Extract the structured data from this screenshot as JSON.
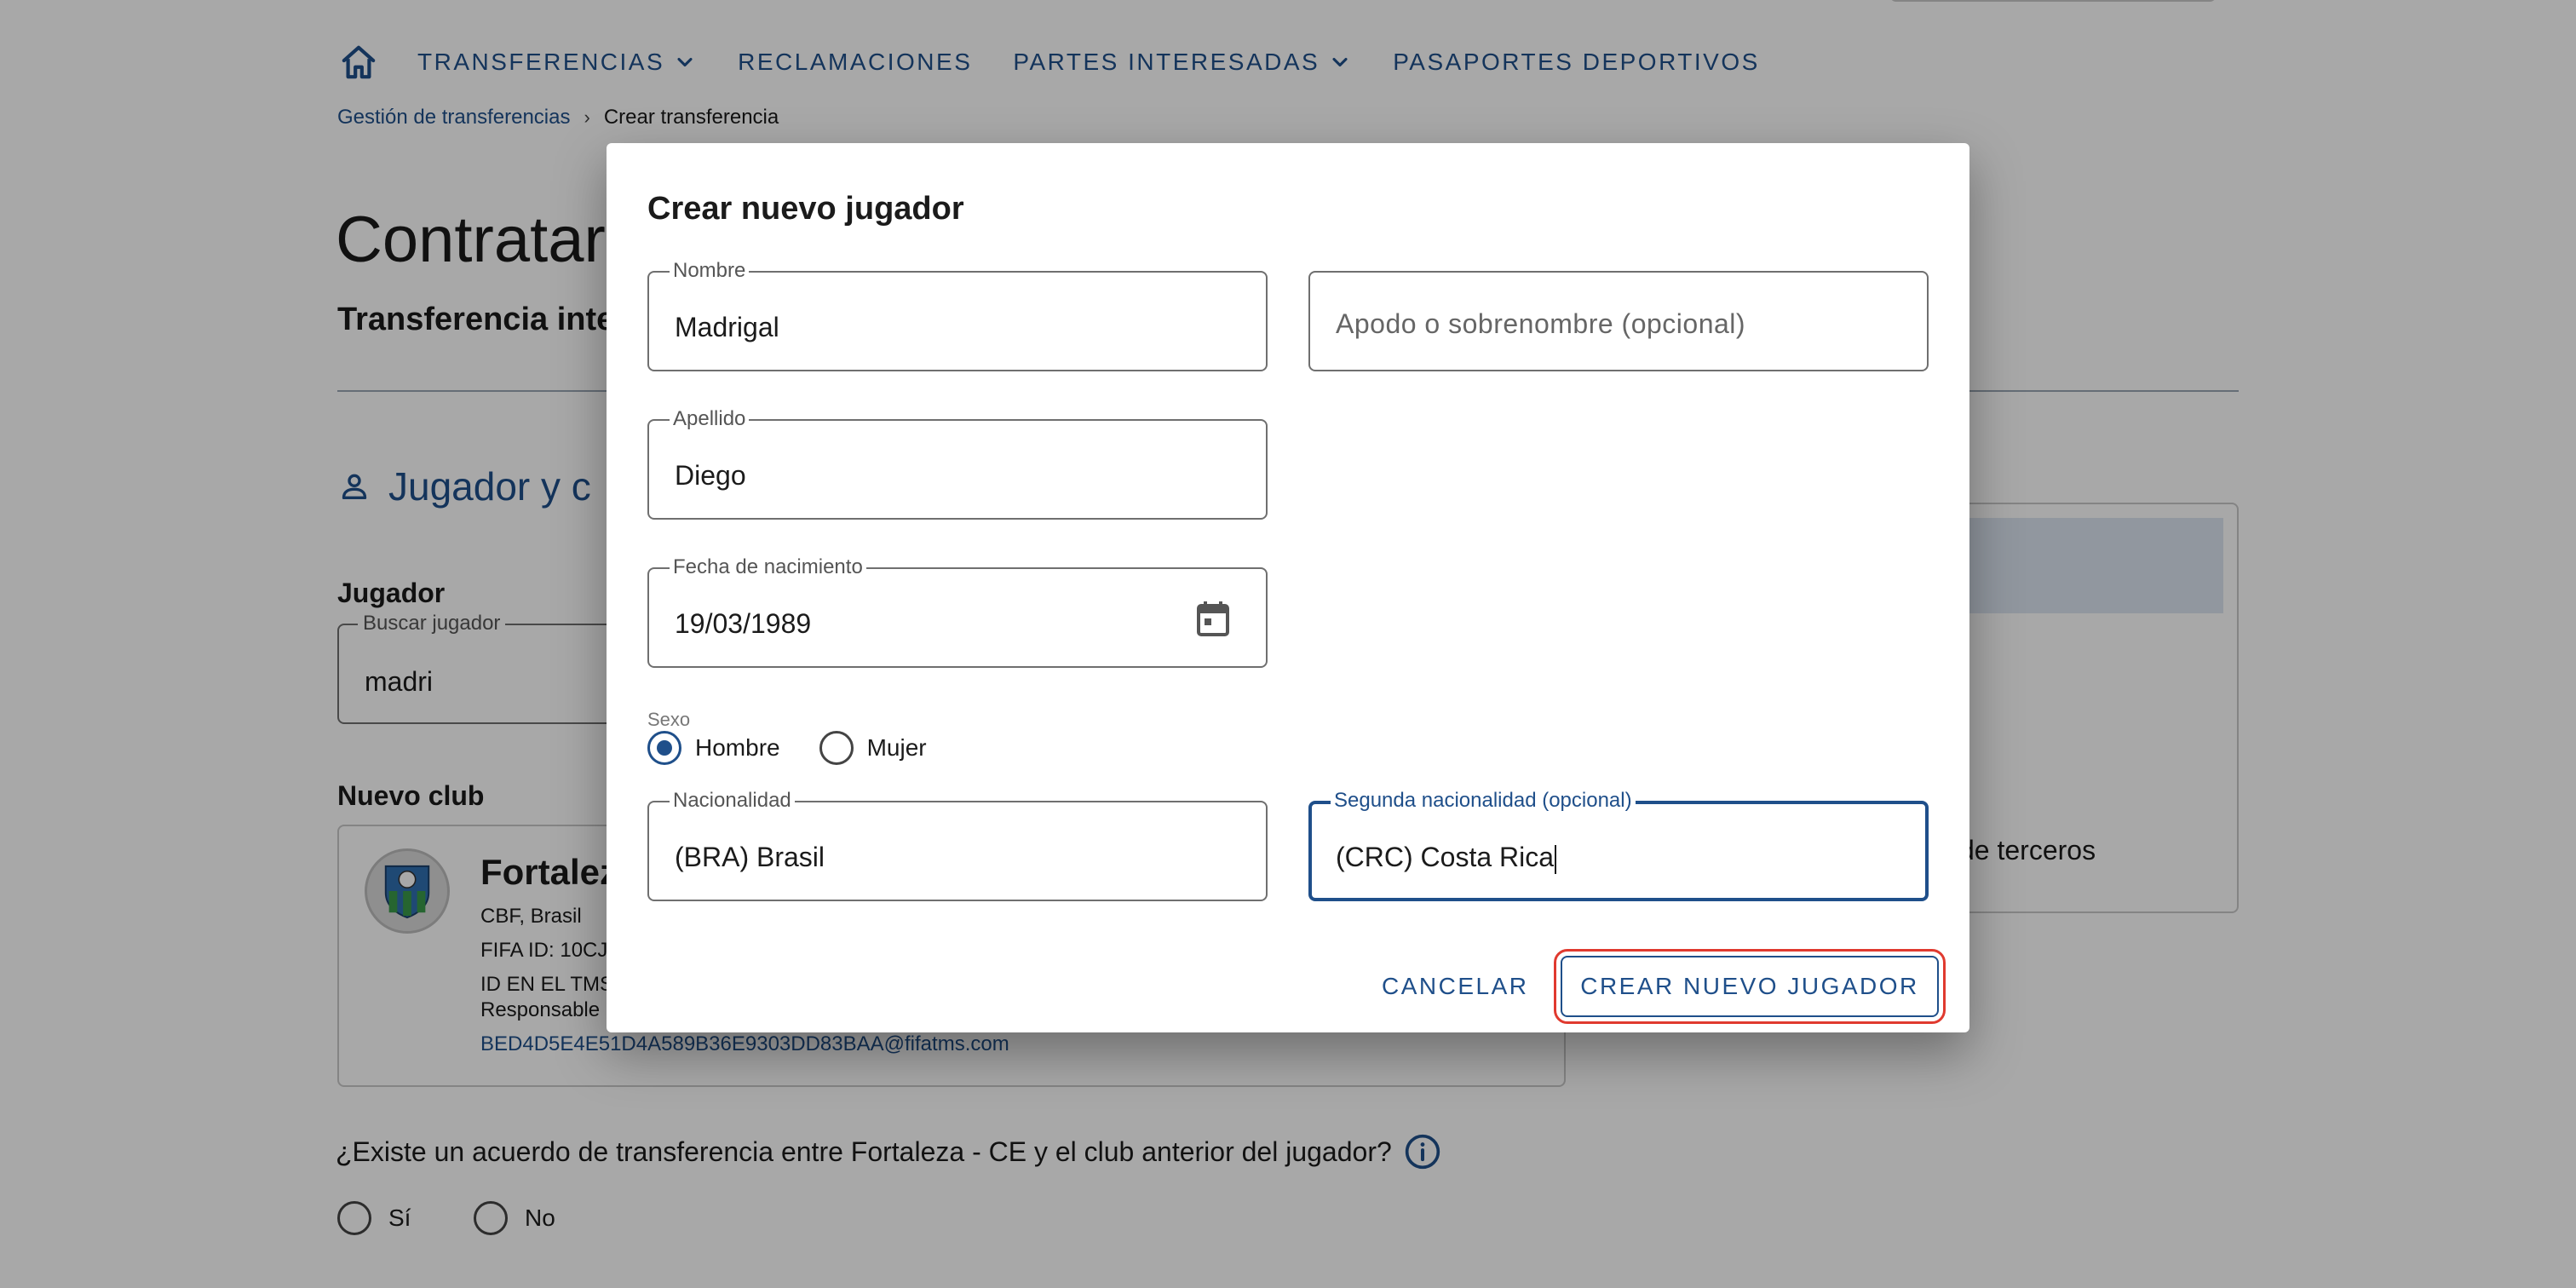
{
  "nav": {
    "items": [
      {
        "label": "TRANSFERENCIAS",
        "dropdown": true
      },
      {
        "label": "RECLAMACIONES",
        "dropdown": false
      },
      {
        "label": "PARTES INTERESADAS",
        "dropdown": true
      },
      {
        "label": "PASAPORTES DEPORTIVOS",
        "dropdown": false
      }
    ],
    "home_icon": "home-icon"
  },
  "breadcrumb": {
    "link": "Gestión de transferencias",
    "separator": "›",
    "current": "Crear transferencia"
  },
  "page": {
    "title": "Contratar",
    "subtitle": "Transferencia inte",
    "section_title": "Jugador y c",
    "player_label": "Jugador",
    "search_label": "Buscar jugador",
    "search_value": "madri",
    "new_club_label": "Nuevo club",
    "club": {
      "name": "Fortalez",
      "association": "CBF, Brasil",
      "fifa_id": "FIFA ID: 10CJ",
      "tms_id": "ID EN EL TMS",
      "responsible": "Responsable",
      "email": "BED4D5E4E51D4A589B36E9303DD83BAA@fifatms.com"
    },
    "right_panel_text": "de terceros",
    "question": "¿Existe un acuerdo de transferencia entre Fortaleza - CE y el club anterior del jugador?",
    "answers": [
      "Sí",
      "No"
    ]
  },
  "dialog": {
    "title": "Crear nuevo jugador",
    "fields": {
      "nombre": {
        "label": "Nombre",
        "value": "Madrigal"
      },
      "apodo": {
        "placeholder": "Apodo o sobrenombre (opcional)"
      },
      "apellido": {
        "label": "Apellido",
        "value": "Diego"
      },
      "fecha": {
        "label": "Fecha de nacimiento",
        "value": "19/03/1989"
      },
      "nacionalidad": {
        "label": "Nacionalidad",
        "value": "(BRA) Brasil"
      },
      "segunda": {
        "label": "Segunda nacionalidad (opcional)",
        "value": "(CRC) Costa Rica"
      }
    },
    "sexo": {
      "label": "Sexo",
      "options": [
        "Hombre",
        "Mujer"
      ],
      "selected": "Hombre"
    },
    "buttons": {
      "cancel": "CANCELAR",
      "create": "CREAR NUEVO JUGADOR"
    }
  },
  "colors": {
    "primary": "#1f4f8a",
    "highlight_ring": "#e03a2f",
    "scrim": "rgba(0,0,0,0.34)"
  }
}
